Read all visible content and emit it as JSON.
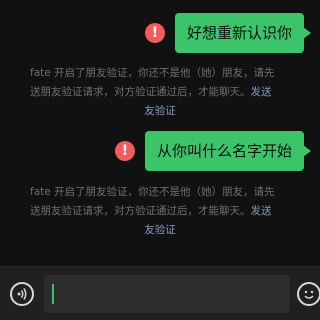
{
  "messages": [
    {
      "text": "好想重新认识你",
      "status": "failed"
    },
    {
      "text": "从你叫什么名字开始",
      "status": "failed"
    }
  ],
  "system_notice": {
    "line1": "fate 开启了朋友验证，你还不是他（她）朋友，请先",
    "line2_prefix": "送朋友验证请求，对方验证通过后，才能聊天。",
    "link_start": "发送",
    "link_end": "友验证"
  },
  "input": {
    "value": "",
    "placeholder": ""
  },
  "icons": {
    "error": "exclamation-icon",
    "voice": "voice-icon",
    "emoji": "emoji-icon"
  },
  "colors": {
    "bubble": "#3CC46A",
    "error": "#F25C5C",
    "link": "#8A98B8",
    "background": "#111111"
  }
}
